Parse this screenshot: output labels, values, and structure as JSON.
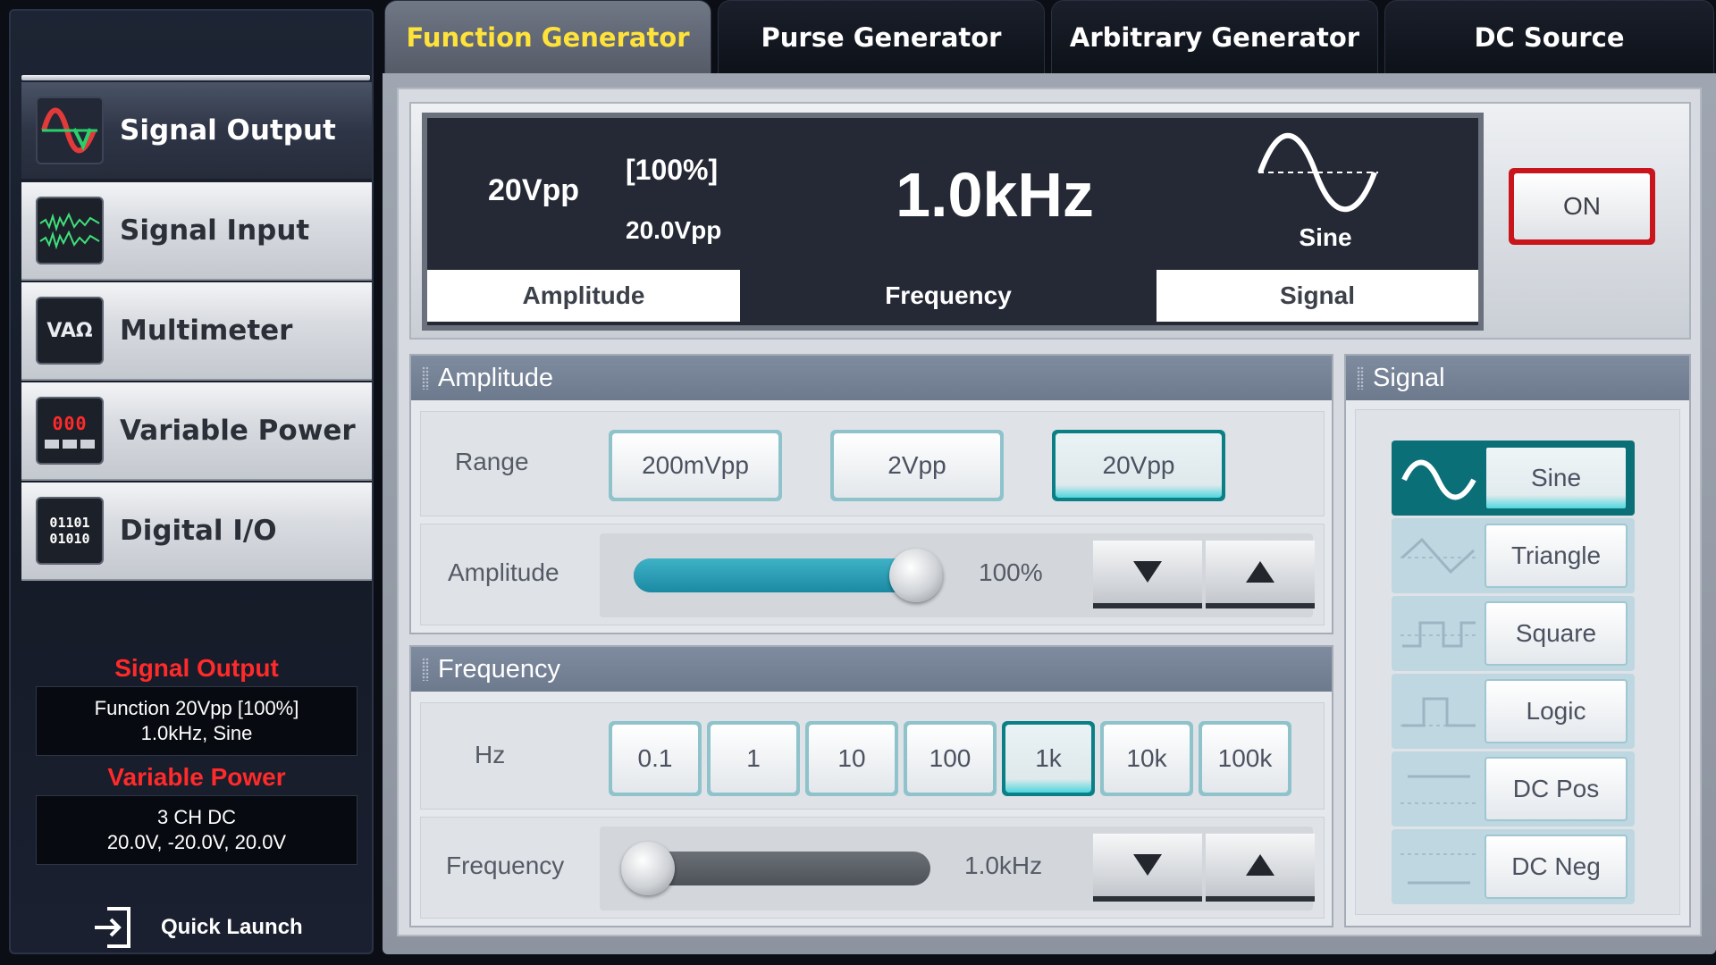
{
  "sidebar": {
    "items": [
      {
        "label": "Signal Output",
        "icon": "signal-output-icon"
      },
      {
        "label": "Signal Input",
        "icon": "signal-input-icon"
      },
      {
        "label": "Multimeter",
        "icon": "multimeter-icon"
      },
      {
        "label": "Variable Power",
        "icon": "variable-power-icon"
      },
      {
        "label": "Digital I/O",
        "icon": "digital-io-icon"
      }
    ],
    "multimeter_icon_text": "VAΩ",
    "power_icon_text": "000",
    "digital_icon_text_1": "01101",
    "digital_icon_text_2": "01010",
    "status": {
      "signal_output_title": "Signal Output",
      "signal_output_line1": "Function 20Vpp [100%]",
      "signal_output_line2": "1.0kHz, Sine",
      "variable_power_title": "Variable Power",
      "variable_power_line1": "3 CH DC",
      "variable_power_line2": "20.0V, -20.0V, 20.0V"
    },
    "quick_launch": "Quick Launch"
  },
  "tabs": [
    {
      "label": "Function Generator",
      "active": true
    },
    {
      "label": "Purse Generator",
      "active": false
    },
    {
      "label": "Arbitrary Generator",
      "active": false
    },
    {
      "label": "DC Source",
      "active": false
    }
  ],
  "display": {
    "amplitude_value": "20Vpp",
    "amplitude_percent": "[100%]",
    "amplitude_actual": "20.0Vpp",
    "frequency_value": "1.0kHz",
    "signal_value": "Sine",
    "amplitude_label": "Amplitude",
    "frequency_label": "Frequency",
    "signal_label": "Signal",
    "output_button": "ON"
  },
  "amplitude_panel": {
    "title": "Amplitude",
    "range_label": "Range",
    "ranges": [
      "200mVpp",
      "2Vpp",
      "20Vpp"
    ],
    "selected_range": "20Vpp",
    "slider_label": "Amplitude",
    "slider_value_text": "100%",
    "slider_fraction": 1.0
  },
  "frequency_panel": {
    "title": "Frequency",
    "hz_label": "Hz",
    "steps": [
      "0.1",
      "1",
      "10",
      "100",
      "1k",
      "10k",
      "100k"
    ],
    "selected_step": "1k",
    "slider_label": "Frequency",
    "slider_value_text": "1.0kHz",
    "slider_fraction": 0.0
  },
  "signal_panel": {
    "title": "Signal",
    "items": [
      "Sine",
      "Triangle",
      "Square",
      "Logic",
      "DC Pos",
      "DC Neg"
    ],
    "selected": "Sine"
  },
  "colors": {
    "accent_teal": "#0b7f86",
    "active_tab_text": "#ffe33a",
    "status_red": "#ff2a2a",
    "on_button_red": "#c8161c"
  }
}
